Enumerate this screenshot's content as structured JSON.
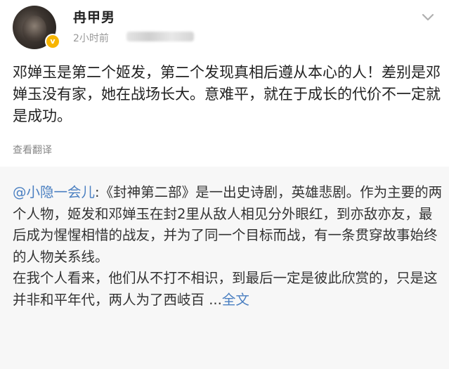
{
  "post": {
    "username": "冉甲男",
    "timestamp": "2小时前",
    "body": "邓婵玉是第二个姬发，第二个发现真相后遵从本心的人！差别是邓婵玉没有家，她在战场长大。意难平，就在于成长的代价不一定就是成功。",
    "translate_label": "查看翻译",
    "more_icon": "chevron-down-icon",
    "verified_icon": "verified-v-badge-icon",
    "verified_label": "v"
  },
  "repost": {
    "mention": "@小隐一会儿",
    "colon": ":",
    "text": "《封神第二部》是一出史诗剧，英雄悲剧。作为主要的两个人物，姬发和邓婵玉在封2里从敌人相见分外眼红，到亦敌亦友，最后成为惺惺相惜的战友，并为了同一个目标而战，有一条贯穿故事始终的人物关系线。",
    "text2": "在我个人看来，他们从不打不相识，到最后一定是彼此欣赏的，只是这并非和平年代，两人为了西岐百",
    "ellipsis": " ...",
    "full_text_label": "全文"
  },
  "colors": {
    "link": "#4a7fc1",
    "muted": "#999999",
    "repost_bg": "#f7f7f7",
    "badge": "#f7b500"
  }
}
